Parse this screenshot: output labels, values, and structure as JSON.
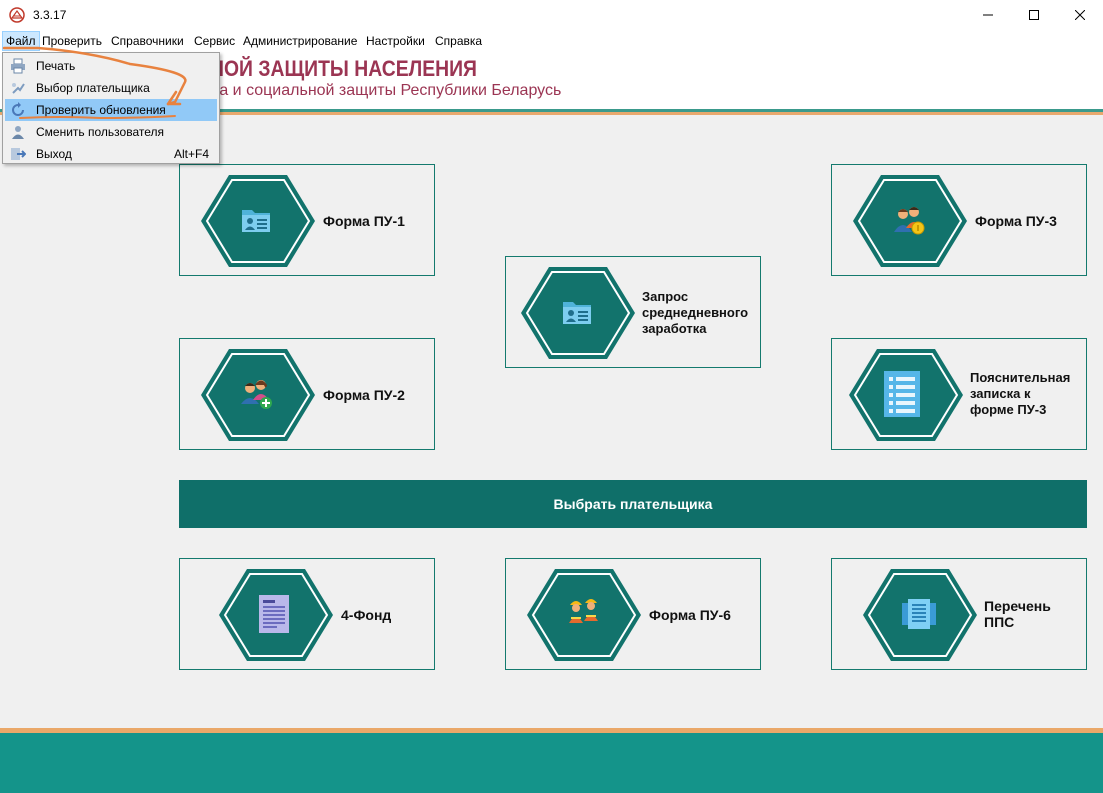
{
  "window": {
    "title": "3.3.17"
  },
  "menubar": {
    "items": [
      {
        "label": "Файл"
      },
      {
        "label": "Проверить"
      },
      {
        "label": "Справочники"
      },
      {
        "label": "Сервис"
      },
      {
        "label": "Администрирование"
      },
      {
        "label": "Настройки"
      },
      {
        "label": "Справка"
      }
    ]
  },
  "file_menu": {
    "items": [
      {
        "label": "Печать",
        "icon": "printer-icon"
      },
      {
        "label": "Выбор плательщика",
        "icon": "pick-payer-icon"
      },
      {
        "label": "Проверить обновления",
        "icon": "refresh-icon"
      },
      {
        "label": "Сменить пользователя",
        "icon": "user-icon"
      },
      {
        "label": "Выход",
        "shortcut": "Alt+F4",
        "icon": "exit-icon"
      }
    ]
  },
  "banner": {
    "title": "НОЙ ЗАЩИТЫ НАСЕЛЕНИЯ",
    "subtitle": "да и социальной защиты Республики Беларусь"
  },
  "cards": {
    "pu1": {
      "label": "Форма ПУ-1",
      "icon": "folder-person-icon"
    },
    "pu3": {
      "label": "Форма ПУ-3",
      "icon": "people-coin-icon"
    },
    "zapros": {
      "label1": "Запрос",
      "label2": "среднедневного",
      "label3": "заработка",
      "icon": "folder-person-icon"
    },
    "pu2": {
      "label": "Форма ПУ-2",
      "icon": "people-add-icon"
    },
    "poyasn": {
      "label1": "Пояснительная",
      "label2": "записка к",
      "label3": "форме ПУ-3",
      "icon": "list-document-icon"
    },
    "fond4": {
      "label": "4-Фонд",
      "icon": "document-icon"
    },
    "pu6": {
      "label": "Форма ПУ-6",
      "icon": "workers-icon"
    },
    "pps": {
      "label1": "Перечень",
      "label2": "ППС",
      "icon": "documents-stack-icon"
    }
  },
  "select_payer_button": {
    "label": "Выбрать плательщика"
  },
  "colors": {
    "teal_dark": "#0f6f69",
    "teal_footer": "#14948a",
    "banner_text": "#9b3553",
    "orange_stripe": "#eaa869",
    "annotation": "#e8823f"
  }
}
